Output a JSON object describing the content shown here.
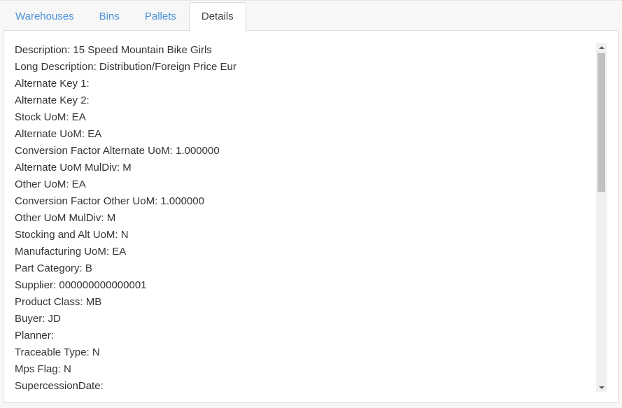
{
  "tabs": [
    {
      "label": "Warehouses",
      "active": false
    },
    {
      "label": "Bins",
      "active": false
    },
    {
      "label": "Pallets",
      "active": false
    },
    {
      "label": "Details",
      "active": true
    }
  ],
  "details": {
    "lines": [
      "Description: 15 Speed Mountain Bike Girls",
      "Long Description: Distribution/Foreign Price Eur",
      "Alternate Key 1:",
      "Alternate Key 2:",
      "Stock UoM: EA",
      "Alternate UoM: EA",
      "Conversion Factor Alternate UoM: 1.000000",
      "Alternate UoM MulDiv: M",
      "Other UoM: EA",
      "Conversion Factor Other UoM: 1.000000",
      "Other UoM MulDiv: M",
      "Stocking and Alt UoM: N",
      "Manufacturing UoM: EA",
      "Part Category: B",
      "Supplier: 000000000000001",
      "Product Class: MB",
      "Buyer: JD",
      "Planner:",
      "Traceable Type: N",
      "Mps Flag: N",
      "SupercessionDate:"
    ]
  },
  "colors": {
    "tab_link": "#4a90d9",
    "text": "#333333",
    "border": "#dcdcdc",
    "scroll_thumb": "#c1c1c1"
  },
  "icons": {
    "scroll_up": "scroll-up-arrow-icon",
    "scroll_down": "scroll-down-arrow-icon"
  }
}
